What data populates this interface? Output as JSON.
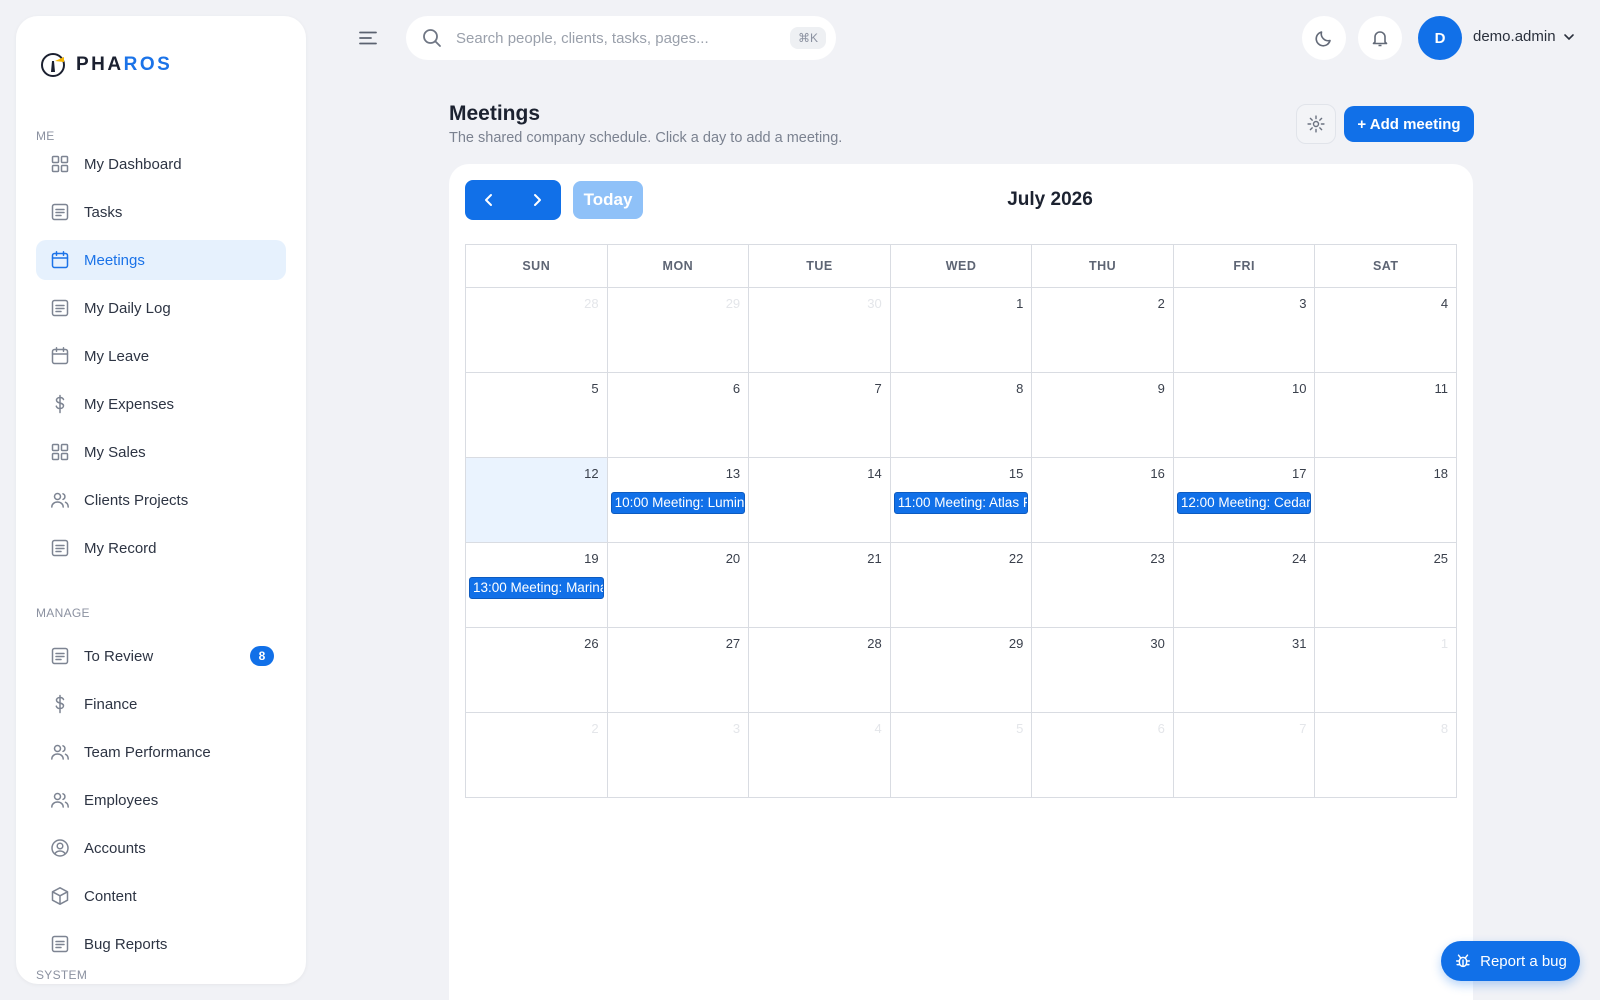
{
  "brand": {
    "prefix": "PHA",
    "accent": "ROS"
  },
  "sidebar": {
    "sections": [
      {
        "label": "ME"
      },
      {
        "label": "MANAGE"
      },
      {
        "label": "SYSTEM"
      }
    ],
    "me_items": [
      {
        "label": "My Dashboard",
        "icon": "grid-icon"
      },
      {
        "label": "Tasks",
        "icon": "document-icon"
      },
      {
        "label": "Meetings",
        "icon": "calendar-icon"
      },
      {
        "label": "My Daily Log",
        "icon": "document-icon"
      },
      {
        "label": "My Leave",
        "icon": "calendar-icon"
      },
      {
        "label": "My Expenses",
        "icon": "dollar-icon"
      },
      {
        "label": "My Sales",
        "icon": "grid-icon"
      },
      {
        "label": "Clients Projects",
        "icon": "users-icon"
      },
      {
        "label": "My Record",
        "icon": "document-icon"
      }
    ],
    "manage_items": [
      {
        "label": "To Review",
        "icon": "document-icon",
        "badge": "8"
      },
      {
        "label": "Finance",
        "icon": "dollar-icon"
      },
      {
        "label": "Team Performance",
        "icon": "users-icon"
      },
      {
        "label": "Employees",
        "icon": "users-icon"
      },
      {
        "label": "Accounts",
        "icon": "user-circle-icon"
      },
      {
        "label": "Content",
        "icon": "box-icon"
      },
      {
        "label": "Bug Reports",
        "icon": "document-icon"
      }
    ],
    "active": "Meetings"
  },
  "topbar": {
    "search_placeholder": "Search people, clients, tasks, pages...",
    "search_shortcut": "⌘K",
    "avatar_initial": "D",
    "username": "demo.admin"
  },
  "page": {
    "title": "Meetings",
    "subtitle": "The shared company schedule. Click a day to add a meeting.",
    "add_label": "+ Add meeting"
  },
  "calendar": {
    "today_label": "Today",
    "month_title": "July 2026",
    "weekdays": [
      "SUN",
      "MON",
      "TUE",
      "WED",
      "THU",
      "FRI",
      "SAT"
    ],
    "weeks": [
      [
        {
          "n": "28",
          "o": true
        },
        {
          "n": "29",
          "o": true
        },
        {
          "n": "30",
          "o": true
        },
        {
          "n": "1"
        },
        {
          "n": "2"
        },
        {
          "n": "3"
        },
        {
          "n": "4"
        }
      ],
      [
        {
          "n": "5"
        },
        {
          "n": "6"
        },
        {
          "n": "7"
        },
        {
          "n": "8"
        },
        {
          "n": "9"
        },
        {
          "n": "10"
        },
        {
          "n": "11"
        }
      ],
      [
        {
          "n": "12",
          "today": true
        },
        {
          "n": "13",
          "event": "10:00 Meeting: Lumin"
        },
        {
          "n": "14"
        },
        {
          "n": "15",
          "event": "11:00 Meeting: Atlas F"
        },
        {
          "n": "16"
        },
        {
          "n": "17",
          "event": "12:00 Meeting: Cedar"
        },
        {
          "n": "18"
        }
      ],
      [
        {
          "n": "19",
          "event": "13:00 Meeting: Marina"
        },
        {
          "n": "20"
        },
        {
          "n": "21"
        },
        {
          "n": "22"
        },
        {
          "n": "23"
        },
        {
          "n": "24"
        },
        {
          "n": "25"
        }
      ],
      [
        {
          "n": "26"
        },
        {
          "n": "27"
        },
        {
          "n": "28"
        },
        {
          "n": "29"
        },
        {
          "n": "30"
        },
        {
          "n": "31"
        },
        {
          "n": "1",
          "o": true
        }
      ],
      [
        {
          "n": "2",
          "o": true
        },
        {
          "n": "3",
          "o": true
        },
        {
          "n": "4",
          "o": true
        },
        {
          "n": "5",
          "o": true
        },
        {
          "n": "6",
          "o": true
        },
        {
          "n": "7",
          "o": true
        },
        {
          "n": "8",
          "o": true
        }
      ]
    ]
  },
  "report_bug_label": "Report a bug",
  "colors": {
    "primary": "#1170e8",
    "active_bg": "#e6f1fd",
    "today_bg": "#eaf3fe"
  }
}
